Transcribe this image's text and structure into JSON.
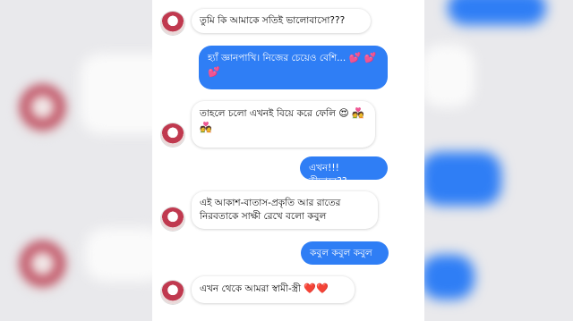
{
  "messages": [
    {
      "side": "in",
      "text": "তুমি কি আমাকে সতিই ভালোবাসো???",
      "emoji": ""
    },
    {
      "side": "out",
      "text": "হ্যাঁ জ্ঞানপাখি। নিজের চেয়েও বেশি...",
      "emoji": "💕 💕💕"
    },
    {
      "side": "in",
      "text": "তাহলে চলো এখনই বিয়ে করে ফেলি",
      "emoji": "😍 💑💑"
    },
    {
      "side": "out",
      "text": "এখন!!! কীভাবে??",
      "emoji": ""
    },
    {
      "side": "in",
      "text": "এই আকাশ-বাতাস-প্রকৃতি আর রাতের নিরবতাকে সাক্ষী রেখে বলো কবুল",
      "emoji": ""
    },
    {
      "side": "out",
      "text": "কবুল কবুল কবুল",
      "emoji": ""
    },
    {
      "side": "in",
      "text": "এখন থেকে আমরা স্বামী-স্ত্রী",
      "emoji": "❤️❤️"
    }
  ],
  "colors": {
    "outgoing_bubble": "#2f7ef5",
    "incoming_bubble": "#ffffff",
    "background": "#e9e9ec"
  }
}
